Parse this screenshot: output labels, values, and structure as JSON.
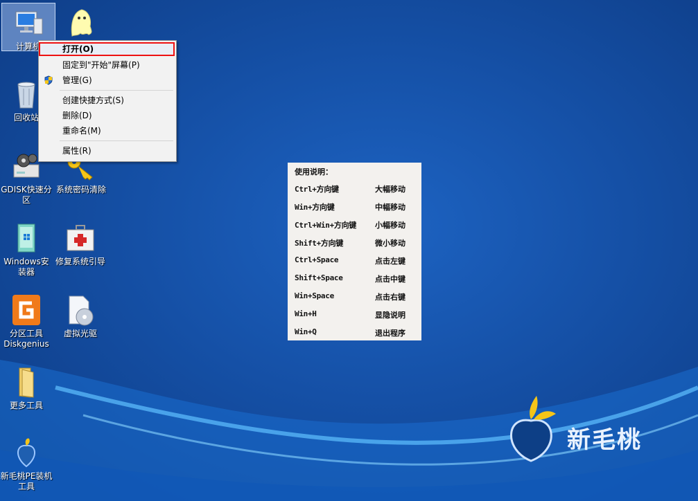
{
  "desktop": {
    "icons": [
      {
        "label": "计算机",
        "icon": "computer-icon"
      },
      {
        "label": "",
        "icon": "ghost-icon"
      },
      {
        "label": "回收站",
        "icon": "recycle-bin-icon"
      },
      {
        "label": "GDISK快速分区",
        "icon": "gear-box-icon"
      },
      {
        "label": "系统密码清除",
        "icon": "key-icon"
      },
      {
        "label": "Windows安装器",
        "icon": "installer-icon"
      },
      {
        "label": "修复系统引导",
        "icon": "first-aid-kit-icon"
      },
      {
        "label": "分区工具Diskgenius",
        "icon": "diskgenius-icon"
      },
      {
        "label": "虚拟光驱",
        "icon": "virtual-drive-icon"
      },
      {
        "label": "更多工具",
        "icon": "folder-icon"
      },
      {
        "label": "新毛桃PE装机工具",
        "icon": "peach-logo-icon"
      }
    ]
  },
  "context_menu": {
    "items": [
      {
        "label": "打开(O)"
      },
      {
        "label": "固定到\"开始\"屏幕(P)"
      },
      {
        "label": "管理(G)"
      },
      {
        "label": "创建快捷方式(S)"
      },
      {
        "label": "删除(D)"
      },
      {
        "label": "重命名(M)"
      },
      {
        "label": "属性(R)"
      }
    ]
  },
  "help_panel": {
    "title": "使用说明：",
    "rows": [
      {
        "keys": "Ctrl+方向键",
        "desc": "大幅移动"
      },
      {
        "keys": "Win+方向键",
        "desc": "中幅移动"
      },
      {
        "keys": "Ctrl+Win+方向键",
        "desc": "小幅移动"
      },
      {
        "keys": "Shift+方向键",
        "desc": "微小移动"
      },
      {
        "keys": "Ctrl+Space",
        "desc": "点击左键"
      },
      {
        "keys": "Shift+Space",
        "desc": "点击中键"
      },
      {
        "keys": "Win+Space",
        "desc": "点击右键"
      },
      {
        "keys": "Win+H",
        "desc": "显隐说明"
      },
      {
        "keys": "Win+Q",
        "desc": "退出程序"
      }
    ]
  },
  "brand": {
    "name": "新毛桃"
  },
  "colors": {
    "highlight_border": "#e11111",
    "desktop_blue": "#1550a6"
  }
}
